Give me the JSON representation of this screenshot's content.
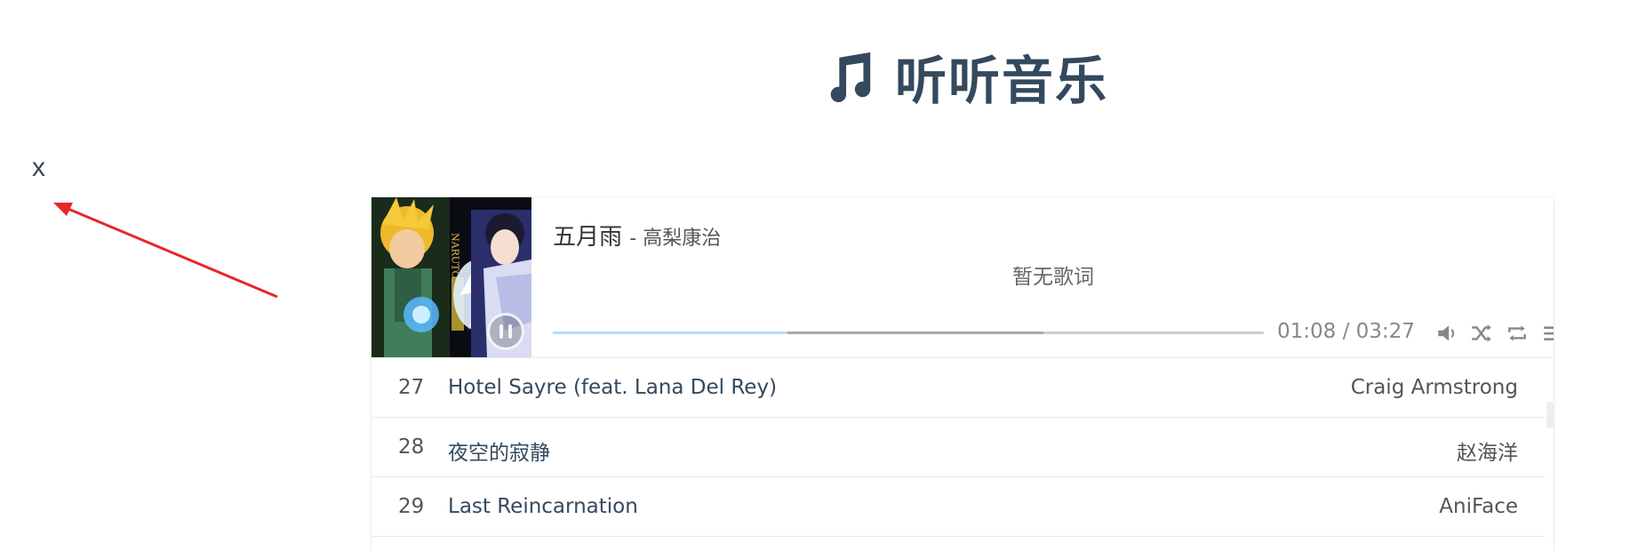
{
  "header": {
    "title": "听听音乐",
    "icon": "music-note-icon"
  },
  "close": {
    "label": "x"
  },
  "colors": {
    "accent": "#34495e",
    "progress_played": "#b7daff",
    "progress_loaded": "#a9a9a9",
    "arrow": "#e8262b"
  },
  "player": {
    "song_title": "五月雨",
    "song_artist": "- 高梨康治",
    "lyric": "暂无歌词",
    "time_current": "01:08",
    "time_total": "03:27",
    "time_display": "01:08 / 03:27",
    "progress_played": 0.33,
    "progress_loaded": 0.69,
    "cover_label": "NARUTO 疾风传"
  },
  "playlist": [
    {
      "index": "27",
      "title": "Hotel Sayre (feat. Lana Del Rey)",
      "artist": "Craig Armstrong"
    },
    {
      "index": "28",
      "title": "夜空的寂静",
      "artist": "赵海洋"
    },
    {
      "index": "29",
      "title": "Last Reincarnation",
      "artist": "AniFace"
    }
  ]
}
